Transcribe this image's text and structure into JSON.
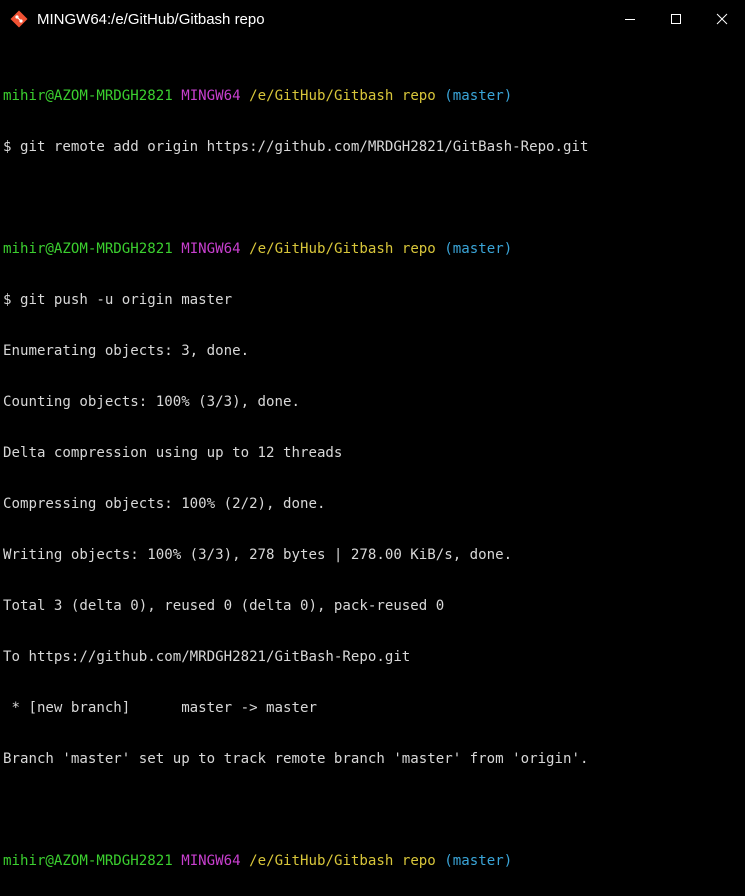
{
  "window": {
    "title": "MINGW64:/e/GitHub/Gitbash repo",
    "controls": [
      "minimize-icon",
      "maximize-icon",
      "close-icon"
    ]
  },
  "colors": {
    "background": "#000000",
    "text": "#d8d8d8",
    "user_host": "#3bcf2f",
    "msystem": "#c83fcf",
    "path": "#d8c63a",
    "branch": "#3aa5d8"
  },
  "terminal": {
    "prompt1": {
      "user_host": "mihir@AZOM-MRDGH2821",
      "msystem": "MINGW64",
      "path": "/e/GitHub/Gitbash repo",
      "branch": "(master)"
    },
    "command1": "$ git remote add origin https://github.com/MRDGH2821/GitBash-Repo.git",
    "prompt2": {
      "user_host": "mihir@AZOM-MRDGH2821",
      "msystem": "MINGW64",
      "path": "/e/GitHub/Gitbash repo",
      "branch": "(master)"
    },
    "command2": "$ git push -u origin master",
    "output": [
      "Enumerating objects: 3, done.",
      "Counting objects: 100% (3/3), done.",
      "Delta compression using up to 12 threads",
      "Compressing objects: 100% (2/2), done.",
      "Writing objects: 100% (3/3), 278 bytes | 278.00 KiB/s, done.",
      "Total 3 (delta 0), reused 0 (delta 0), pack-reused 0",
      "To https://github.com/MRDGH2821/GitBash-Repo.git",
      " * [new branch]      master -> master",
      "Branch 'master' set up to track remote branch 'master' from 'origin'."
    ],
    "prompt3": {
      "user_host": "mihir@AZOM-MRDGH2821",
      "msystem": "MINGW64",
      "path": "/e/GitHub/Gitbash repo",
      "branch": "(master)"
    },
    "command3": "$ "
  }
}
